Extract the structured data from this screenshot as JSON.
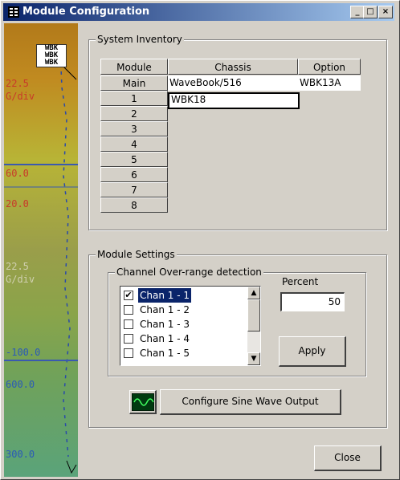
{
  "window": {
    "title": "Module Configuration",
    "title_icon": "app-grid-icon"
  },
  "title_buttons": {
    "minimize": "_",
    "maximize": "□",
    "close": "×"
  },
  "sidebar": {
    "logo_lines": [
      "WBK",
      "WBK",
      "WBK"
    ],
    "labels": [
      "22.5",
      "G/div",
      "60.0",
      "20.0",
      "22.5",
      "G/div",
      "-100.0",
      "600.0",
      "300.0"
    ]
  },
  "inventory": {
    "group_title": "System Inventory",
    "columns": [
      "Module",
      "Chassis",
      "Option"
    ],
    "rows": [
      {
        "module": "Main",
        "chassis": "WaveBook/516",
        "option": "WBK13A"
      },
      {
        "module": "1",
        "chassis": "WBK18",
        "option": ""
      },
      {
        "module": "2",
        "chassis": "",
        "option": ""
      },
      {
        "module": "3",
        "chassis": "",
        "option": ""
      },
      {
        "module": "4",
        "chassis": "",
        "option": ""
      },
      {
        "module": "5",
        "chassis": "",
        "option": ""
      },
      {
        "module": "6",
        "chassis": "",
        "option": ""
      },
      {
        "module": "7",
        "chassis": "",
        "option": ""
      },
      {
        "module": "8",
        "chassis": "",
        "option": ""
      }
    ]
  },
  "settings": {
    "group_title": "Module Settings",
    "overrange": {
      "group_title": "Channel Over-range detection",
      "channels": [
        {
          "label": "Chan 1 - 1",
          "checked": true,
          "selected": true
        },
        {
          "label": "Chan 1 - 2",
          "checked": false,
          "selected": false
        },
        {
          "label": "Chan 1 - 3",
          "checked": false,
          "selected": false
        },
        {
          "label": "Chan 1 - 4",
          "checked": false,
          "selected": false
        },
        {
          "label": "Chan 1 - 5",
          "checked": false,
          "selected": false
        }
      ],
      "percent_label": "Percent",
      "percent_value": "50",
      "apply_label": "Apply"
    },
    "sine_button_label": "Configure Sine Wave Output",
    "sine_icon": "sine-wave-icon"
  },
  "close_label": "Close",
  "colors": {
    "title_start": "#0a246a",
    "title_end": "#a6caf0",
    "selection": "#0a246a",
    "face": "#d4d0c8"
  }
}
